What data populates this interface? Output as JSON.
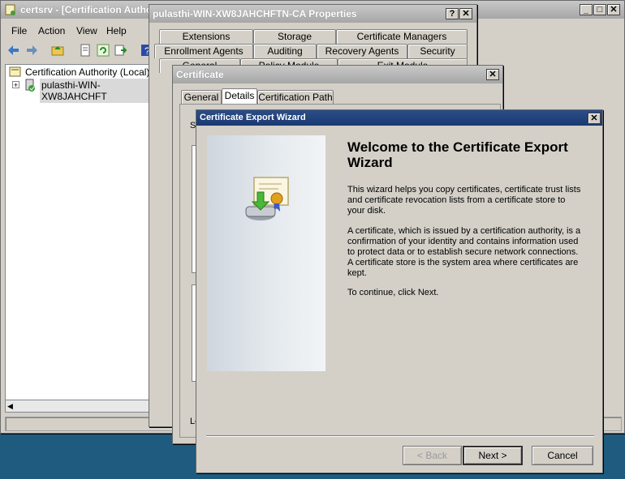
{
  "certsrv": {
    "title": "certsrv - [Certification Autho",
    "menu": [
      "File",
      "Action",
      "View",
      "Help"
    ],
    "tree_root": "Certification Authority (Local)",
    "tree_child": "pulasthi-WIN-XW8JAHCHFT"
  },
  "props": {
    "title": "pulasthi-WIN-XW8JAHCHFTN-CA Properties",
    "tabs_row1": [
      "Extensions",
      "Storage",
      "Certificate Managers"
    ],
    "tabs_row2": [
      "Enrollment Agents",
      "Auditing",
      "Recovery Agents",
      "Security"
    ],
    "tabs_row3": [
      "General",
      "Policy Module",
      "Exit Module"
    ]
  },
  "cert": {
    "title": "Certificate",
    "tabs": [
      "General",
      "Details",
      "Certification Path"
    ],
    "partial_label_1": "Sh",
    "partial_label_2": "Le"
  },
  "wizard": {
    "title": "Certificate Export Wizard",
    "heading": "Welcome to the Certificate Export Wizard",
    "para1": "This wizard helps you copy certificates, certificate trust lists and certificate revocation lists from a certificate store to your disk.",
    "para2": "A certificate, which is issued by a certification authority, is a confirmation of your identity and contains information used to protect data or to establish secure network connections. A certificate store is the system area where certificates are kept.",
    "para3": "To continue, click Next.",
    "back_label": "< Back",
    "next_label": "Next >",
    "cancel_label": "Cancel"
  },
  "colors": {
    "desktop": "#1f5b7e",
    "title_active": "#1a3a73",
    "dialog_bg": "#d4d0c8"
  }
}
